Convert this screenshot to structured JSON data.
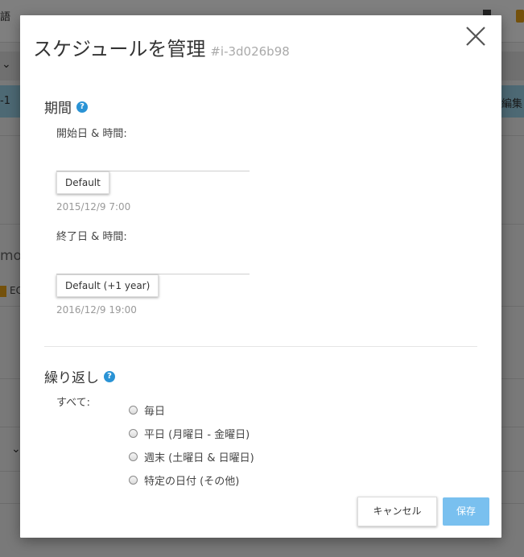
{
  "background": {
    "lang_label": "語",
    "row_left": "-1",
    "row_right": "編集",
    "side_text": "mo",
    "side_badge": "EC"
  },
  "modal": {
    "title": "スケジュールを管理",
    "instance_id": "#i-3d026b98",
    "period": {
      "title": "期間",
      "help": "?",
      "start_label": "開始日 & 時間:",
      "start_button": "Default",
      "start_hint": "2015/12/9 7:00",
      "end_label": "終了日 & 時間:",
      "end_button": "Default (+1 year)",
      "end_hint": "2016/12/9 19:00"
    },
    "repeat": {
      "title": "繰り返し",
      "help": "?",
      "all_label": "すべて:",
      "options": [
        "毎日",
        "平日 (月曜日 - 金曜日)",
        "週末 (土曜日 & 日曜日)",
        "特定の日付 (その他)"
      ]
    },
    "cancel_label": "キャンセル",
    "save_label": "保存"
  },
  "colors": {
    "accent": "#2a93d5",
    "save_button": "#79c0ef",
    "highlight_row": "#9bd2e8"
  }
}
